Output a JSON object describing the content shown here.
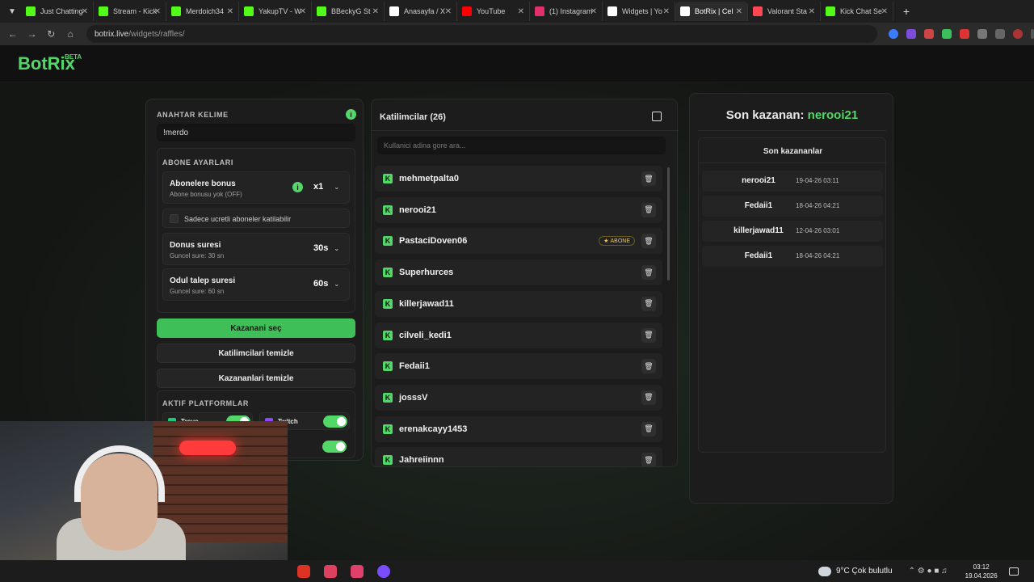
{
  "browser": {
    "tabs": [
      {
        "title": "Just Chatting",
        "color": "#53fc18",
        "active": false
      },
      {
        "title": "Stream - Kick",
        "color": "#53fc18",
        "active": false
      },
      {
        "title": "Merdoich34",
        "color": "#53fc18",
        "active": false
      },
      {
        "title": "YakupTV - W",
        "color": "#53fc18",
        "active": false
      },
      {
        "title": "BBeckyG St",
        "color": "#53fc18",
        "active": false
      },
      {
        "title": "Anasayfa / X",
        "color": "#ffffff",
        "active": false
      },
      {
        "title": "YouTube",
        "color": "#ff0000",
        "active": false
      },
      {
        "title": "(1) Instagram",
        "color": "#e1306c",
        "active": false
      },
      {
        "title": "Widgets | Yo",
        "color": "#ffffff",
        "active": false
      },
      {
        "title": "BotRix | Cel",
        "color": "#ffffff",
        "active": true
      },
      {
        "title": "Valorant Sta",
        "color": "#ff4655",
        "active": false
      },
      {
        "title": "Kick Chat Se",
        "color": "#53fc18",
        "active": false
      }
    ],
    "url_host": "botrix.live",
    "url_path": "/widgets/raffles/"
  },
  "app": {
    "logo": "BotRix",
    "logo_tag": "BETA"
  },
  "settings": {
    "keyword_label": "ANAHTAR KELIME",
    "keyword_value": "!merdo",
    "sub_section": "ABONE AYARLARI",
    "sub_bonus_title": "Abonelere bonus",
    "sub_bonus_sub": "Abone bonusu yok (OFF)",
    "sub_bonus_value": "x1",
    "paid_only": "Sadece ucretli aboneler katilabilir",
    "bonus_time_title": "Donus suresi",
    "bonus_time_sub": "Guncel sure: 30 sn",
    "bonus_time_value": "30s",
    "claim_title": "Odul talep suresi",
    "claim_sub": "Guncel sure: 60 sn",
    "claim_value": "60s",
    "pick_winner": "Kazanani seç",
    "clear_participants": "Katilimcilari temizle",
    "clear_winners": "Kazananlari temizle",
    "platforms_label": "AKTIF PLATFORMLAR",
    "platform_trovo": "Trovo",
    "platform_twitch": "Twitch"
  },
  "participants": {
    "header": "Katilimcilar (26)",
    "search_placeholder": "Kullanici adina gore ara...",
    "sub_badge": "ABONE",
    "list": [
      "mehmetpalta0",
      "nerooi21",
      "PastaciDoven06",
      "Superhurces",
      "killerjawad11",
      "cilveli_kedi1",
      "Fedaii1",
      "josssV",
      "erenakcayy1453",
      "Jahreiinnn"
    ]
  },
  "winners": {
    "last_label": "Son kazanan:",
    "last_name": "nerooi21",
    "recent_title": "Son kazananlar",
    "list": [
      {
        "name": "nerooi21",
        "date": "19-04-26 03:11"
      },
      {
        "name": "Fedaii1",
        "date": "18-04-26 04:21"
      },
      {
        "name": "killerjawad11",
        "date": "12-04-26 03:01"
      },
      {
        "name": "Fedaii1",
        "date": "18-04-26 04:21"
      }
    ]
  },
  "taskbar": {
    "weather": "9°C  Çok bulutlu",
    "time": "03:12",
    "date": "19.04.2026"
  }
}
